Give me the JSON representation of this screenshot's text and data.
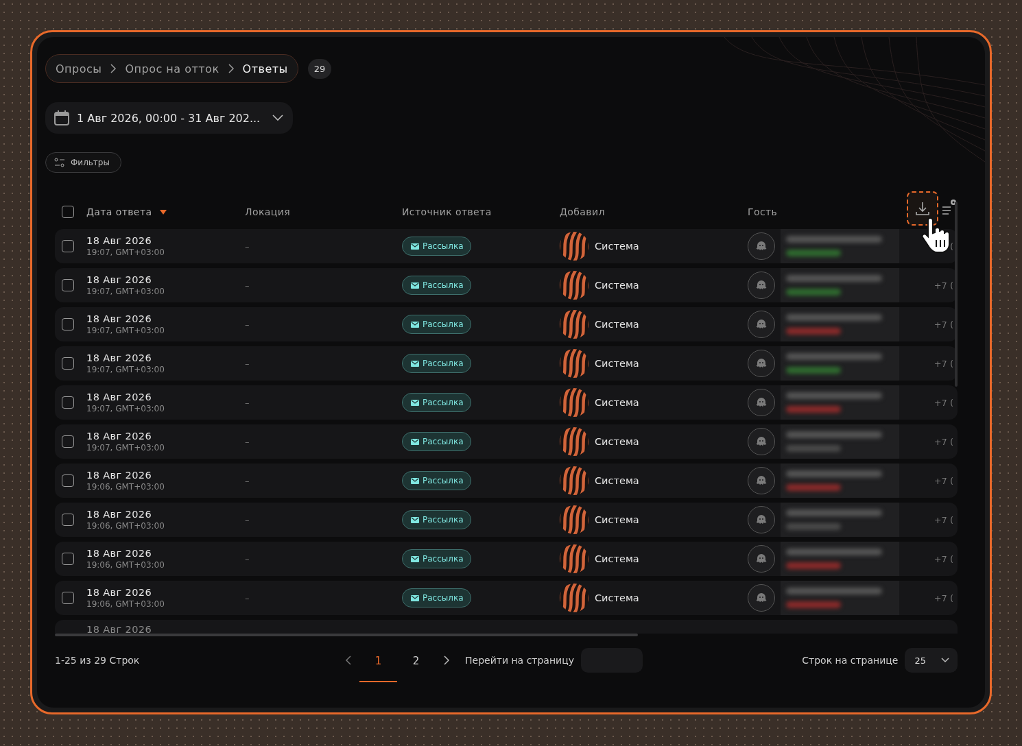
{
  "breadcrumbs": [
    {
      "label": "Опросы",
      "selected": false
    },
    {
      "label": "Опрос на отток",
      "selected": false
    },
    {
      "label": "Ответы",
      "selected": true
    }
  ],
  "count_badge": "29",
  "date_range": {
    "value": "1 Авг 2026, 00:00 - 31 Авг 202..."
  },
  "filters_button": "Фильтры",
  "table": {
    "select_all": {
      "checked": false
    },
    "columns": [
      {
        "label": "Дата ответа",
        "sorted": true
      },
      {
        "label": "Локация",
        "sorted": false
      },
      {
        "label": "Источник ответа",
        "sorted": false
      },
      {
        "label": "Добавил",
        "sorted": false
      },
      {
        "label": "Гость",
        "sorted": false
      }
    ],
    "rows": [
      {
        "kind": "full",
        "checked": false,
        "date": "18 Авг 2026",
        "time": "19:07, GMT+03:00",
        "location": "–",
        "source": "Рассылка",
        "added_by": "Система",
        "guest": {
          "color": "#2f6b2f"
        },
        "extra": "("
      },
      {
        "kind": "full",
        "checked": false,
        "date": "18 Авг 2026",
        "time": "19:07, GMT+03:00",
        "location": "–",
        "source": "Рассылка",
        "added_by": "Система",
        "guest": {
          "color": "#2f6b2f"
        },
        "extra": "+7 ("
      },
      {
        "kind": "full",
        "checked": false,
        "date": "18 Авг 2026",
        "time": "19:07, GMT+03:00",
        "location": "–",
        "source": "Рассылка",
        "added_by": "Система",
        "guest": {
          "color": "#8a2a2a"
        },
        "extra": "+7 ("
      },
      {
        "kind": "full",
        "checked": false,
        "date": "18 Авг 2026",
        "time": "19:07, GMT+03:00",
        "location": "–",
        "source": "Рассылка",
        "added_by": "Система",
        "guest": {
          "color": "#2f6b2f"
        },
        "extra": "+7 ("
      },
      {
        "kind": "full",
        "checked": false,
        "date": "18 Авг 2026",
        "time": "19:07, GMT+03:00",
        "location": "–",
        "source": "Рассылка",
        "added_by": "Система",
        "guest": {
          "color": "#8a2a2a"
        },
        "extra": "+7 ("
      },
      {
        "kind": "full",
        "checked": false,
        "date": "18 Авг 2026",
        "time": "19:07, GMT+03:00",
        "location": "–",
        "source": "Рассылка",
        "added_by": "Система",
        "guest": {
          "color": "#4a4a4a"
        },
        "extra": "+7 ("
      },
      {
        "kind": "full",
        "checked": false,
        "date": "18 Авг 2026",
        "time": "19:06, GMT+03:00",
        "location": "–",
        "source": "Рассылка",
        "added_by": "Система",
        "guest": {
          "color": "#8a2a2a"
        },
        "extra": "+7 ("
      },
      {
        "kind": "full",
        "checked": false,
        "date": "18 Авг 2026",
        "time": "19:06, GMT+03:00",
        "location": "–",
        "source": "Рассылка",
        "added_by": "Система",
        "guest": {
          "color": "#4a4a4a"
        },
        "extra": "+7 ("
      },
      {
        "kind": "full",
        "checked": false,
        "date": "18 Авг 2026",
        "time": "19:06, GMT+03:00",
        "location": "–",
        "source": "Рассылка",
        "added_by": "Система",
        "guest": {
          "color": "#8a2a2a"
        },
        "extra": "+7 ("
      },
      {
        "kind": "full",
        "checked": false,
        "date": "18 Авг 2026",
        "time": "19:06, GMT+03:00",
        "location": "–",
        "source": "Рассылка",
        "added_by": "Система",
        "guest": {
          "color": "#8a2a2a"
        },
        "extra": "+7 ("
      },
      {
        "kind": "partial",
        "date": "18 Авг 2026"
      }
    ]
  },
  "pagination": {
    "summary": "1-25 из 29 Строк",
    "pages": [
      {
        "label": "1",
        "selected": true
      },
      {
        "label": "2",
        "selected": false
      }
    ],
    "goto_label": "Перейти на страницу",
    "rows_label": "Строк на странице",
    "rows_per_page": "25"
  }
}
